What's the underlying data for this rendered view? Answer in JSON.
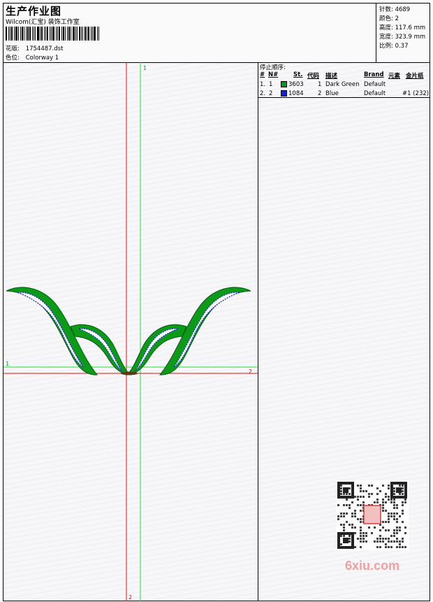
{
  "header": {
    "title": "生产作业图",
    "studio": "Wilcom(汇宝) 装饰工作室",
    "design_label": "花版:",
    "design_value": "1754487.dst",
    "colorway_label": "色位:",
    "colorway_value": "Colorway 1"
  },
  "stats": {
    "stitches": "针数: 4689",
    "colors": "颜色: 2",
    "height": "高度: 117.6 mm",
    "width": "宽度: 323.9 mm",
    "scale": "比例: 0.37"
  },
  "guides": {
    "v_green_top": "1",
    "h_green_left": "1",
    "h_red_right": "2",
    "v_red_bottom": "2"
  },
  "colors_table": {
    "stop_sequence_label": "停止顺序:",
    "headers": {
      "num": "#",
      "n": "N#",
      "st": "St.",
      "code": "代码",
      "desc": "描述",
      "brand": "Brand",
      "element": "元素",
      "thread": "金片纸"
    },
    "rows": [
      {
        "num": "1.",
        "n": "1",
        "swatch": "#009a1a",
        "st": "3603",
        "code": "1",
        "desc": "Dark Green",
        "brand": "Default",
        "element": "",
        "thread": ""
      },
      {
        "num": "2.",
        "n": "2",
        "swatch": "#1020d8",
        "st": "1084",
        "code": "2",
        "desc": "Blue",
        "brand": "Default",
        "element": "",
        "thread": "#1 (232)"
      }
    ]
  },
  "watermark": {
    "text": "6xiu.com"
  },
  "palette": {
    "green": "#0c9a18",
    "blue": "#1f2fd0",
    "guide_green": "#22dd33",
    "guide_red": "#dd1111"
  }
}
